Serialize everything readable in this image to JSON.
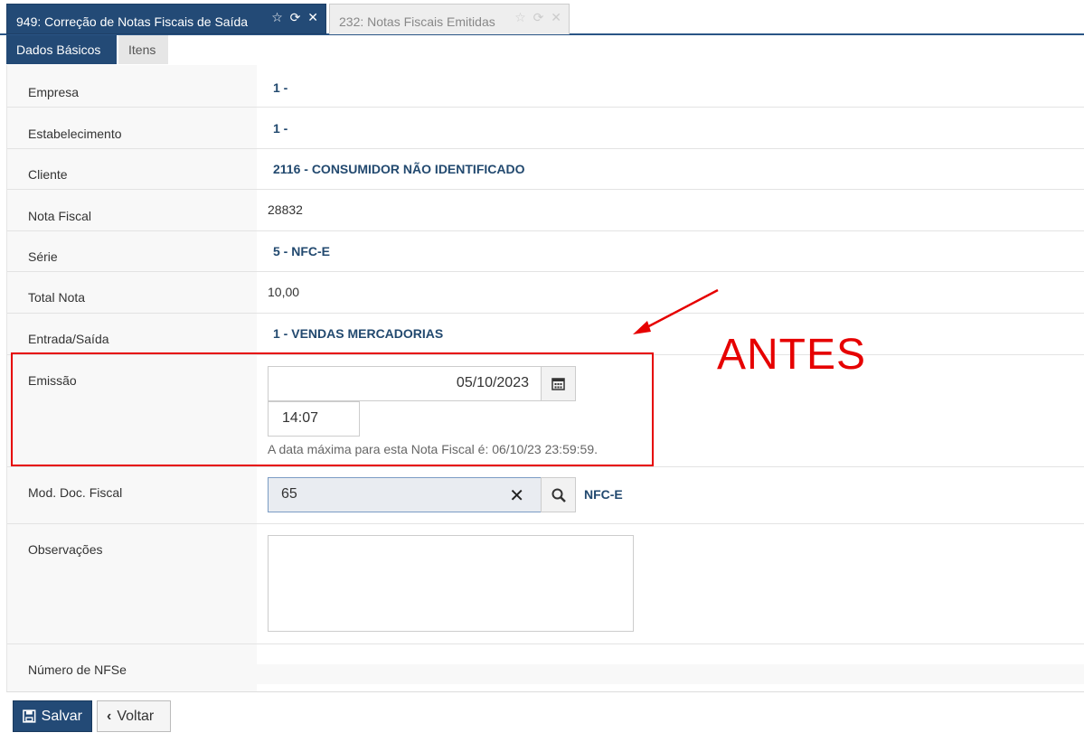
{
  "top_tabs": [
    {
      "label": "949: Correção de Notas Fiscais de Saída",
      "icons": "☆ ⟳ ✕"
    },
    {
      "label": "232: Notas Fiscais Emitidas",
      "icons": "☆ ⟳ ✕"
    }
  ],
  "sub_tabs": [
    "Dados Básicos",
    "Itens"
  ],
  "fields": {
    "empresa": {
      "label": "Empresa",
      "value": "1 -"
    },
    "estabelecimento": {
      "label": "Estabelecimento",
      "value": "1 -"
    },
    "cliente": {
      "label": "Cliente",
      "value": "2116 - CONSUMIDOR NÃO IDENTIFICADO"
    },
    "nota_fiscal": {
      "label": "Nota Fiscal",
      "value": "28832"
    },
    "serie": {
      "label": "Série",
      "value": "5 - NFC-E"
    },
    "total_nota": {
      "label": "Total Nota",
      "value": "10,00"
    },
    "entrada_saida": {
      "label": "Entrada/Saída",
      "value": "1 - VENDAS MERCADORIAS"
    },
    "emissao": {
      "label": "Emissão",
      "date": "05/10/2023",
      "time": "14:07",
      "help": "A data máxima para esta Nota Fiscal é: 06/10/23 23:59:59."
    },
    "mod_doc_fiscal": {
      "label": "Mod. Doc. Fiscal",
      "value": "65",
      "description": "NFC-E"
    },
    "observacoes": {
      "label": "Observações",
      "value": ""
    },
    "numero_nfse": {
      "label": "Número de NFSe"
    }
  },
  "annotation": {
    "text": "ANTES",
    "color": "#e60000"
  },
  "buttons": {
    "save": "Salvar",
    "back": "Voltar"
  },
  "colors": {
    "primary": "#234a76",
    "value_text": "#22496f"
  }
}
